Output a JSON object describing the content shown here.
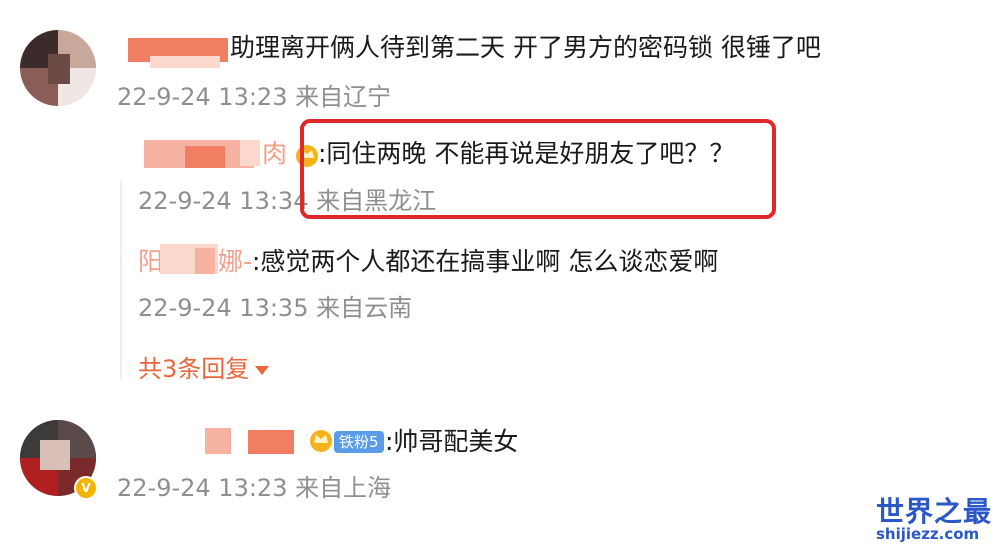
{
  "comments": [
    {
      "text": "助理离开俩人待到第二天 开了男方的密码锁 很锤了吧",
      "meta": "22-9-24 13:23 来自辽宁",
      "replies": [
        {
          "text": ":同住两晚 不能再说是好朋友了吧？？",
          "meta": "22-9-24 13:34 来自黑龙江",
          "name_tail": "肉"
        },
        {
          "text": ":感觉两个人都还在搞事业啊 怎么谈恋爱啊",
          "meta": "22-9-24 13:35 来自云南",
          "name_tail": "阳",
          "name_tail2": "娜-"
        }
      ],
      "more_replies": "共3条回复"
    },
    {
      "text": ":帅哥配美女",
      "meta": "22-9-24 13:23 来自上海",
      "badge": "铁粉5"
    }
  ],
  "watermark": {
    "cn": "世界之最",
    "en": "shijiezz.com"
  },
  "colors": {
    "highlight": "#e02828",
    "accent": "#e8673b",
    "badge": "#4a90e2"
  }
}
